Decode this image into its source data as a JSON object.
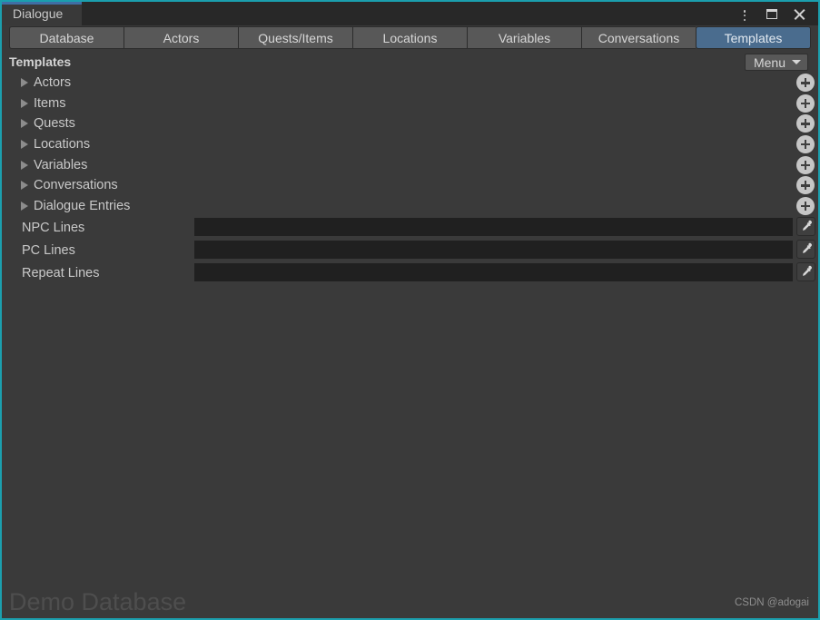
{
  "window": {
    "doc_tab_label": "Dialogue",
    "controls": [
      {
        "name": "more-options",
        "icon": "kebab-icon"
      },
      {
        "name": "maximize",
        "icon": "maximize-icon"
      },
      {
        "name": "close",
        "icon": "close-icon"
      }
    ],
    "border_color": "#1b9fae",
    "titlebar_bg": "#282828",
    "body_bg": "#3a3a3a",
    "accent_color": "#4a6c8e"
  },
  "tabs": [
    {
      "label": "Database",
      "selected": false
    },
    {
      "label": "Actors",
      "selected": false
    },
    {
      "label": "Quests/Items",
      "selected": false
    },
    {
      "label": "Locations",
      "selected": false
    },
    {
      "label": "Variables",
      "selected": false
    },
    {
      "label": "Conversations",
      "selected": false
    },
    {
      "label": "Templates",
      "selected": true
    }
  ],
  "section": {
    "title": "Templates",
    "menu_label": "Menu"
  },
  "tree_rows": [
    {
      "label": "Actors",
      "expandable": true,
      "add_button": true
    },
    {
      "label": "Items",
      "expandable": true,
      "add_button": true
    },
    {
      "label": "Quests",
      "expandable": true,
      "add_button": true
    },
    {
      "label": "Locations",
      "expandable": true,
      "add_button": true
    },
    {
      "label": "Variables",
      "expandable": true,
      "add_button": true
    },
    {
      "label": "Conversations",
      "expandable": true,
      "add_button": true
    },
    {
      "label": "Dialogue Entries",
      "expandable": true,
      "add_button": true
    }
  ],
  "color_rows": [
    {
      "label": "NPC Lines",
      "color": "#ff0000",
      "alpha_color": "#ffffff"
    },
    {
      "label": "PC Lines",
      "color": "#0000f0",
      "alpha_color": "#ffffff"
    },
    {
      "label": "Repeat Lines",
      "color": "#8a8a8a",
      "alpha_color": "#ffffff"
    }
  ],
  "footer": {
    "database_name": "Demo Database",
    "watermark": "CSDN @adogai"
  }
}
